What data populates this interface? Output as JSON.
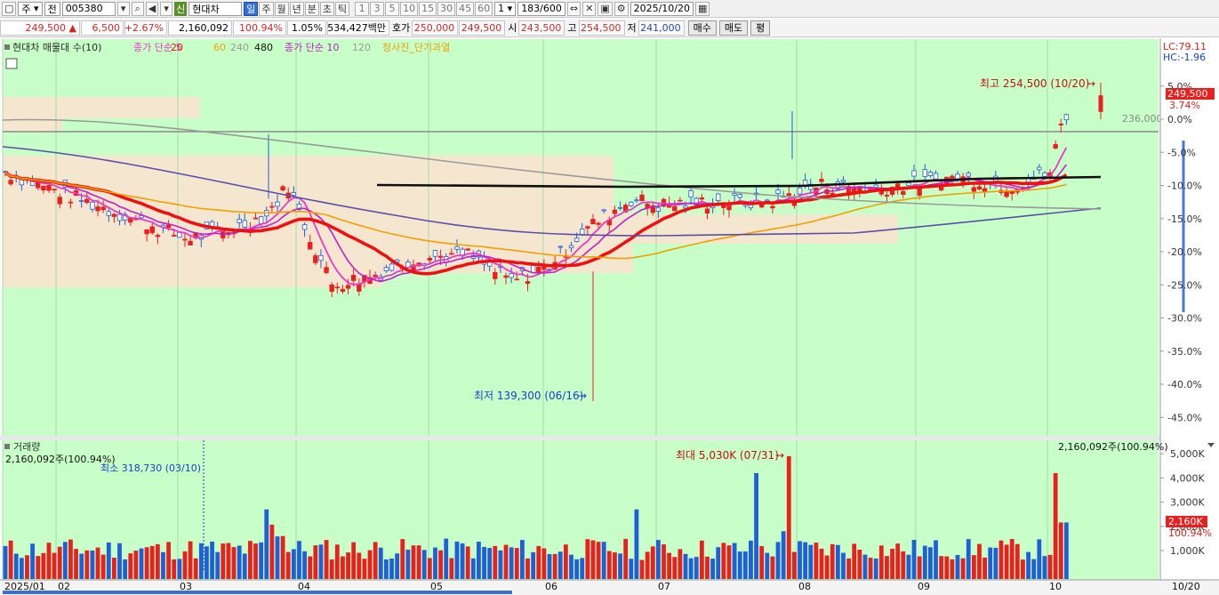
{
  "toolbar": {
    "item1": "주",
    "item2": "전",
    "code": "005380",
    "badge": "신",
    "name": "현대차",
    "periods": [
      "일",
      "주",
      "월",
      "년",
      "분",
      "초",
      "틱"
    ],
    "numbers": [
      "1",
      "3",
      "5",
      "10",
      "15",
      "30",
      "45",
      "60"
    ],
    "count_select": "1",
    "counter": "183/600",
    "date": "2025/10/20"
  },
  "quote": {
    "price": "249,500",
    "change": "6,500",
    "pct": "+2.67%",
    "volume": "2,160,092",
    "vol_ratio": "100.94%",
    "turnover_rate": "1.05%",
    "amount": "534,427백만",
    "bid_label": "호가",
    "bid1": "250,000",
    "bid2": "249,500",
    "open_label": "시",
    "open": "243,500",
    "high_label": "고",
    "high": "254,500",
    "low_label": "저",
    "low": "241,000",
    "buy_label": "매수",
    "sell_label": "매도",
    "flat_label": "평"
  },
  "chart_data": {
    "type": "candlestick",
    "legend": [
      "현대차 매물대 수(10)",
      "종가 단순 5",
      "20",
      "60",
      "240",
      "480",
      "종가 단순 10",
      "120",
      "청사진_단기과열"
    ],
    "lc_label": "LC:79.11",
    "hc_label": "HC:-1.96",
    "price_axis_unit": "%",
    "y_ticks_pct": [
      5,
      0,
      -5,
      -10,
      -15,
      -20,
      -25,
      -30,
      -35,
      -40,
      -45
    ],
    "reference_price": 236000,
    "reference_label": "236,000",
    "current_price_label": "249,500",
    "current_pct_label": "3.74%",
    "annotations": {
      "high": "최고 254,500 (10/20)",
      "low": "최저 139,300 (06/16)",
      "vol_max": "최대 5,030K (07/31)",
      "vol_min": "최소 318,730 (03/10)"
    },
    "months": [
      "2025/01",
      "02",
      "03",
      "04",
      "05",
      "06",
      "07",
      "08",
      "09",
      "10"
    ],
    "last_date": "10/20",
    "volume_title": "거래량",
    "volume_label": "2,160,092주(100.94%)",
    "volume_right_label": "2,160,092주(100.94%)",
    "volume_current_label": "2,160K",
    "volume_current_pct": "100.94%",
    "volume_ticks": [
      1000,
      2000,
      3000,
      4000,
      5000
    ],
    "volume_tick_labels": [
      "1,000K",
      "2,000K",
      "3,000K",
      "4,000K",
      "5,000K"
    ],
    "colors": {
      "up": "#e8201e",
      "down": "#1f5fd8",
      "bg": "#c8ffc8",
      "ma5": "#e83ac8",
      "ma20": "#ee1111",
      "ma60": "#f0a000",
      "ma240": "#5a4ea8",
      "ma480": "#999999",
      "ma120": "#101010"
    }
  }
}
